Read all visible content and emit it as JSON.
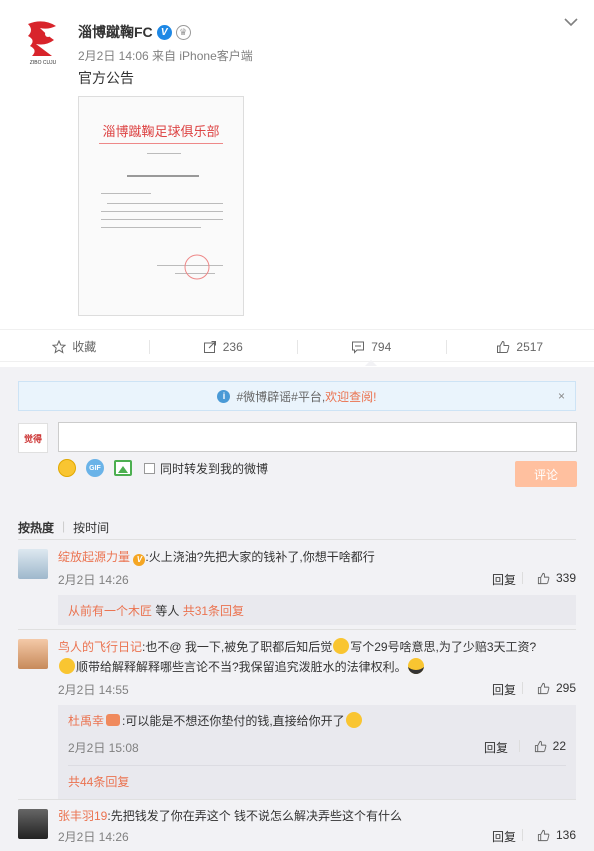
{
  "post": {
    "author": "淄博蹴鞠FC",
    "verified_badge": "V",
    "crown_badge": "♛",
    "meta": "2月2日 14:06 来自 iPhone客户端",
    "text": "官方公告",
    "avatar_caption": "ZIBO CUJU",
    "document": {
      "title": "淄博蹴鞠足球俱乐部"
    }
  },
  "actions": {
    "favorite": "收藏",
    "repost": "236",
    "comment": "794",
    "like": "2517"
  },
  "notice": {
    "before": "#微博辟谣#平台,",
    "highlight": "欢迎查阅!",
    "close": "×"
  },
  "composer": {
    "avatar_text": "觉得",
    "sync_label": "同时转发到我的微博",
    "submit": "评论",
    "gif_label": "GIF"
  },
  "sort": {
    "hot": "按热度",
    "time": "按时间"
  },
  "comments": [
    {
      "user": "绽放起源力量",
      "badge": "V",
      "text": ":火上浇油?先把大家的钱补了,你想干啥都行",
      "time": "2月2日 14:26",
      "reply": "回复",
      "likes": "339",
      "sub_summary": {
        "user": "从前有一个木匠",
        "mid": " 等人 ",
        "count": "共31条回复"
      }
    },
    {
      "user": "鸟人的飞行日记",
      "text_a": ":也不@ 我一下,被免了职都后知后觉",
      "text_b": "写个29号啥意思,为了少赔3天工资?",
      "text_c": "顺带给解释解释哪些言论不当?我保留追究泼脏水的法律权利。",
      "time": "2月2日 14:55",
      "reply": "回复",
      "likes": "295",
      "sub_reply": {
        "user": "杜禹幸",
        "text": ":可以能是不想还你垫付的钱,直接给你开了",
        "time": "2月2日 15:08",
        "reply": "回复",
        "likes": "22"
      },
      "sub_total": "共44条回复"
    },
    {
      "user": "张丰羽19",
      "text": ":先把钱发了你在弄这个 钱不说怎么解决弄些这个有什么",
      "time": "2月2日 14:26",
      "reply": "回复",
      "likes": "136"
    }
  ]
}
